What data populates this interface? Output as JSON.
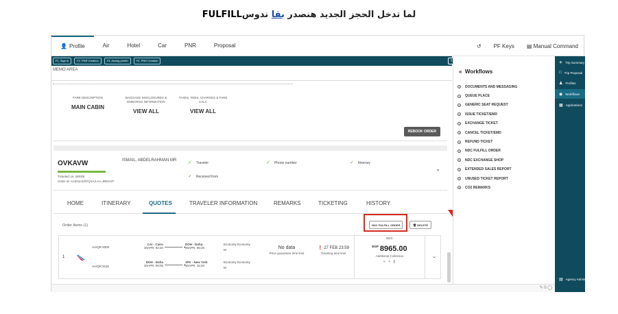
{
  "caption": {
    "part1": "لما تدخل الحجز الجديد هنصدر ",
    "part2": "بقا",
    "part3": " ندوس",
    "part4": "FULFILL"
  },
  "topnav": {
    "items": [
      "Profile",
      "Air",
      "Hotel",
      "Car",
      "PNR",
      "Proposal"
    ],
    "right": [
      "PF Keys",
      "Manual Command"
    ]
  },
  "fkeys": [
    "F1. Sign in",
    "F2. PNR Creation",
    "F3. Assing printer",
    "F4. PNR Creation"
  ],
  "memo": {
    "label": "MEMO AREA"
  },
  "fare": {
    "cols": [
      {
        "header": "FARE DESCRIPTION",
        "value": "MAIN CABIN"
      },
      {
        "header": "BAGGAGE DISCLOSURES & EMBARGO INFORMATION",
        "value": "VIEW ALL"
      },
      {
        "header": "TAXES, FEES, CHARGES & FARE CALC",
        "value": "VIEW ALL"
      }
    ],
    "rebook": "REBOOK ORDER"
  },
  "pnr": {
    "locator": "OVKAVW",
    "ticketed": "Ticketed on: 26FEB",
    "order_id": "Order Id: AA001H1RPQYA3  AA-JRDXVP",
    "passenger": "ISMAIL, ABDELRAHMAN MR",
    "checks": [
      "Traveler",
      "Phone number",
      "Itinerary",
      "Received from"
    ]
  },
  "tabs": [
    "HOME",
    "ITINERARY",
    "QUOTES",
    "TRAVELER INFORMATION",
    "REMARKS",
    "TICKETING",
    "HISTORY"
  ],
  "order": {
    "items_label": "Order Items (1)",
    "ndc_fulfill": "NDC FULFILL ORDER",
    "delete": "DELETE",
    "index": "1",
    "segments": [
      {
        "flight": "AA/QR 8300",
        "from_city": "CAI - Cairo",
        "from_time": "30APR, 02:20",
        "to_city": "DOH - Doha",
        "to_time": "30APR, 05:25",
        "cabin": "Economy Economy",
        "class": "M"
      },
      {
        "flight": "AA/QR 8115",
        "from_city": "DOH - Doha",
        "from_time": "30APR, 08:05",
        "to_city": "JFK - New York",
        "to_time": "30APR, 15:20",
        "cabin": "Economy Economy",
        "class": "M"
      }
    ],
    "price_guarantee": {
      "title": "No data",
      "sub": "Price guarantee time limit"
    },
    "ticketing_limit": {
      "title": "27 FEB 23:59",
      "sub": "Ticketing time limit"
    },
    "price": {
      "tag": "NDC",
      "currency": "EGP",
      "amount": "8965.00",
      "sub": "Additional Collection"
    }
  },
  "workflows": {
    "title": "Workflows",
    "items": [
      "DOCUMENTS AND MESSAGING",
      "QUEUE PLACE",
      "GENERIC SEAT REQUEST",
      "ISSUE TICKET/EMD",
      "EXCHANGE TICKET",
      "CANCEL TICKET/EMD",
      "REFUND TICKET",
      "NDC FULFILL ORDER",
      "NDC EXCHANGE SHOP",
      "EXTENDED SALES REPORT",
      "UNUSED TICKET REPORT",
      "CO2 REMARKS"
    ]
  },
  "sidebar": {
    "items": [
      "Trip Summary",
      "Trip Proposal",
      "Profiles",
      "Workflows",
      "Applications"
    ],
    "bottom": "Agency Admin"
  },
  "colors": {
    "brand": "#0f4b5c",
    "accent": "#1a6b84",
    "highlight": "#d42a1f",
    "ok": "#5aa83b"
  }
}
